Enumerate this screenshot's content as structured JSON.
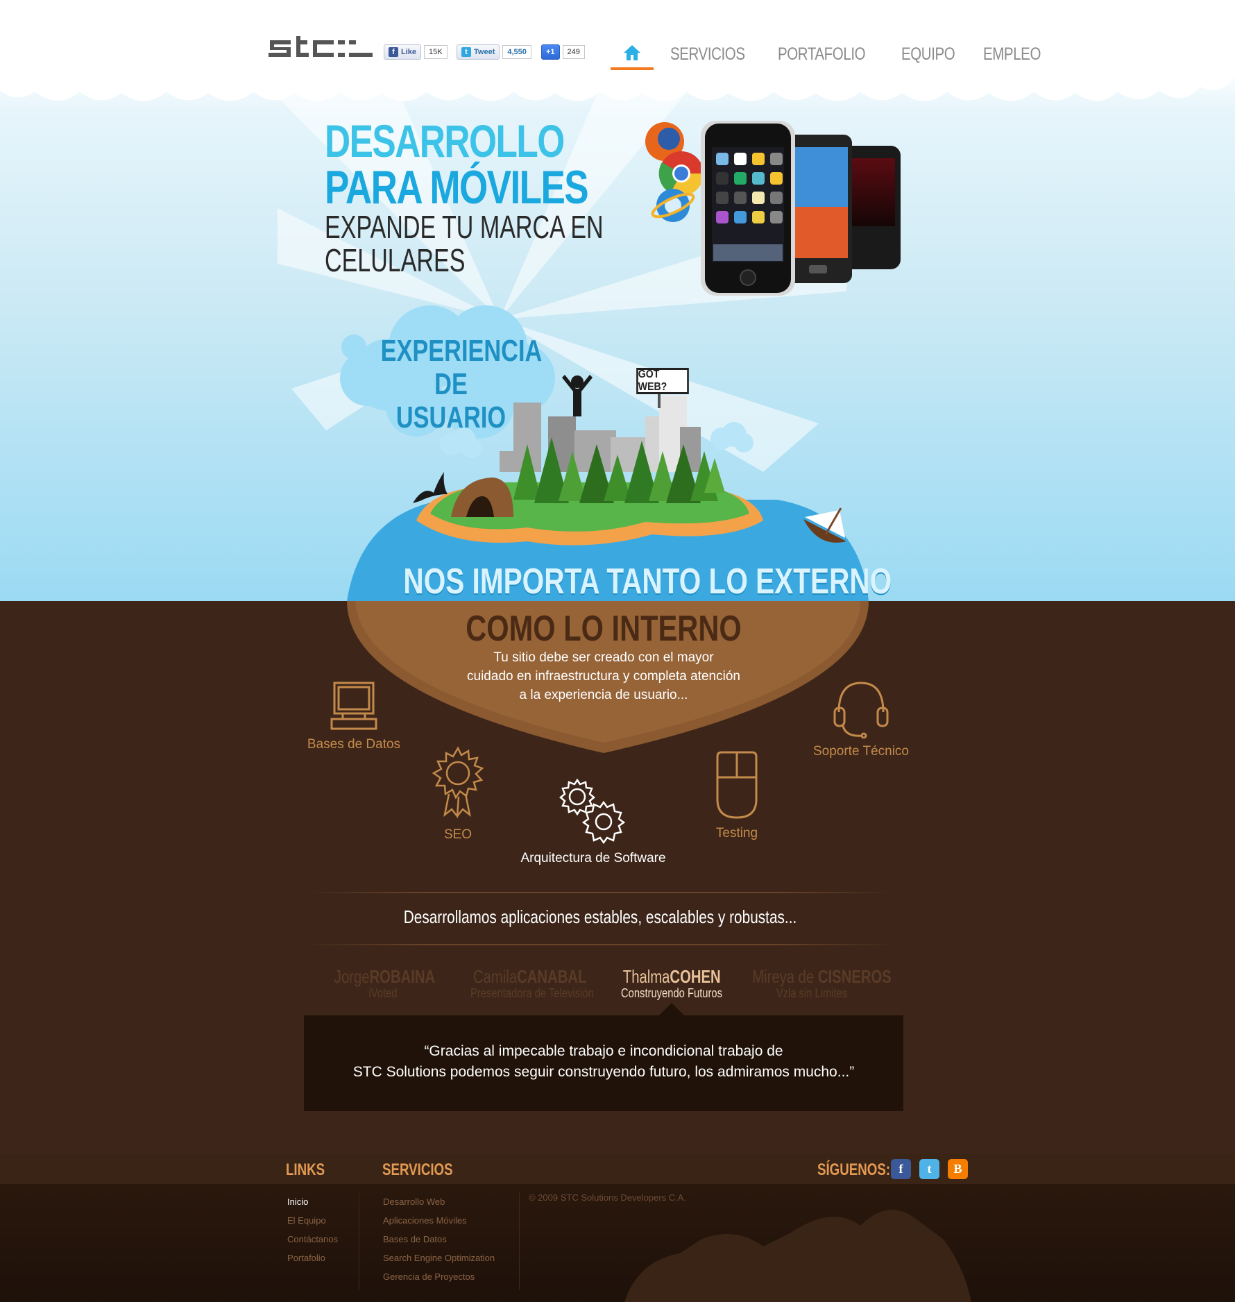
{
  "header": {
    "logo_text": "stc:.",
    "social": {
      "like_label": "Like",
      "like_count": "15K",
      "tweet_label": "Tweet",
      "tweet_count": "4,550",
      "plus_label": "+1",
      "plus_count": "249"
    },
    "nav": [
      "SERVICIOS",
      "PORTAFOLIO",
      "EQUIPO",
      "EMPLEO"
    ]
  },
  "hero": {
    "line1": "DESARROLLO",
    "line2": "PARA MÓVILES",
    "line3": "EXPANDE TU MARCA EN",
    "line4": "CELULARES"
  },
  "island": {
    "ux_line1": "EXPERIENCIA",
    "ux_line2": "DE USUARIO",
    "sign": "GOT WEB?",
    "external": "NOS IMPORTA TANTO LO EXTERNO"
  },
  "internal": {
    "title": "COMO LO INTERNO",
    "text_line1": "Tu sitio debe ser creado con el mayor",
    "text_line2": "cuidado en infraestructura y completa atención",
    "text_line3": "a la experiencia de usuario...",
    "services": {
      "db": "Bases de Datos",
      "support": "Soporte Técnico",
      "seo": "SEO",
      "arch": "Arquitectura de Software",
      "testing": "Testing"
    },
    "tagline": "Desarrollamos aplicaciones estables, escalables y robustas..."
  },
  "testimonials": {
    "people": [
      {
        "first": "Jorge",
        "last": "ROBAINA",
        "role": "iVoted"
      },
      {
        "first": "Camila",
        "last": "CANABAL",
        "role": "Presentadora de Televisión"
      },
      {
        "first": "Thalma",
        "last": "COHEN",
        "role": "Construyendo Futuros"
      },
      {
        "first": "Mireya de ",
        "last": "CISNEROS",
        "role": "Vzla sin Limites"
      }
    ],
    "quote_line1": "“Gracias al impecable trabajo e incondicional trabajo de",
    "quote_line2": "STC Solutions podemos seguir construyendo futuro, los admiramos mucho...”"
  },
  "footer": {
    "links_heading": "LINKS",
    "links": [
      "Inicio",
      "El Equipo",
      "Contáctanos",
      "Portafolio"
    ],
    "services_heading": "SERVICIOS",
    "services": [
      "Desarrollo Web",
      "Aplicaciones Móviles",
      "Bases de Datos",
      "Search Engine Optimization",
      "Gerencia de Proyectos"
    ],
    "copyright": "© 2009 STC Solutions Developers C.A.",
    "follow_heading": "SÍGUENOS:",
    "social_icons": [
      "facebook-icon",
      "twitter-icon",
      "blogger-icon"
    ]
  },
  "colors": {
    "accent_orange": "#f47a20",
    "sky_blue": "#3ec3e8",
    "brown_dark": "#3d2619",
    "footer_heading": "#e39a52"
  }
}
